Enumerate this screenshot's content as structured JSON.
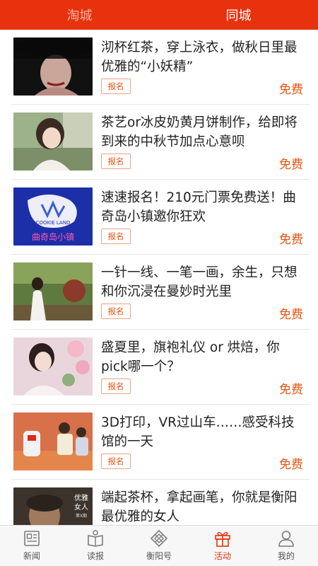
{
  "top_tabs": [
    {
      "label": "淘城",
      "active": false
    },
    {
      "label": "同城",
      "active": true
    }
  ],
  "events": [
    {
      "title": "沏杯红茶，穿上泳衣，做秋日里最优雅的“小妖精”",
      "signup_label": "报名",
      "price": "免费"
    },
    {
      "title": "茶艺or冰皮奶黄月饼制作，给即将到来的中秋节加点心意呗",
      "signup_label": "报名",
      "price": "免费"
    },
    {
      "title": "速速报名！210元门票免费送！曲奇岛小镇邀你狂欢",
      "signup_label": "报名",
      "price": "免费",
      "thumb_text": {
        "top": "COOKIE LAND",
        "bottom": "曲奇岛小镇"
      }
    },
    {
      "title": "一针一线、一笔一画，余生，只想和你沉浸在曼妙时光里",
      "signup_label": "报名",
      "price": "免费"
    },
    {
      "title": "盛夏里，旗袍礼仪 or 烘焙，你pick哪一个？",
      "signup_label": "报名",
      "price": "免费"
    },
    {
      "title": "3D打印，VR过山车……感受科技馆的一天",
      "signup_label": "报名",
      "price": "免费"
    },
    {
      "title": "端起茶杯，拿起画笔，你就是衡阳最优雅的女人",
      "signup_label": "报名",
      "price": "免费",
      "thumb_text": {
        "top": "优雅",
        "middle": "女人",
        "bottom": "第X期"
      }
    }
  ],
  "bottom_nav": [
    {
      "label": "新闻",
      "icon": "news-icon",
      "active": false
    },
    {
      "label": "读报",
      "icon": "read-paper-icon",
      "active": false
    },
    {
      "label": "衡阳号",
      "icon": "hengyang-account-icon",
      "active": false
    },
    {
      "label": "活动",
      "icon": "gift-icon",
      "active": true
    },
    {
      "label": "我的",
      "icon": "user-icon",
      "active": false
    }
  ],
  "colors": {
    "brand": "#e8320e",
    "accent": "#e8520e",
    "inactive_tab": "#f7b29f",
    "nav_icon": "#7a7a7a"
  }
}
